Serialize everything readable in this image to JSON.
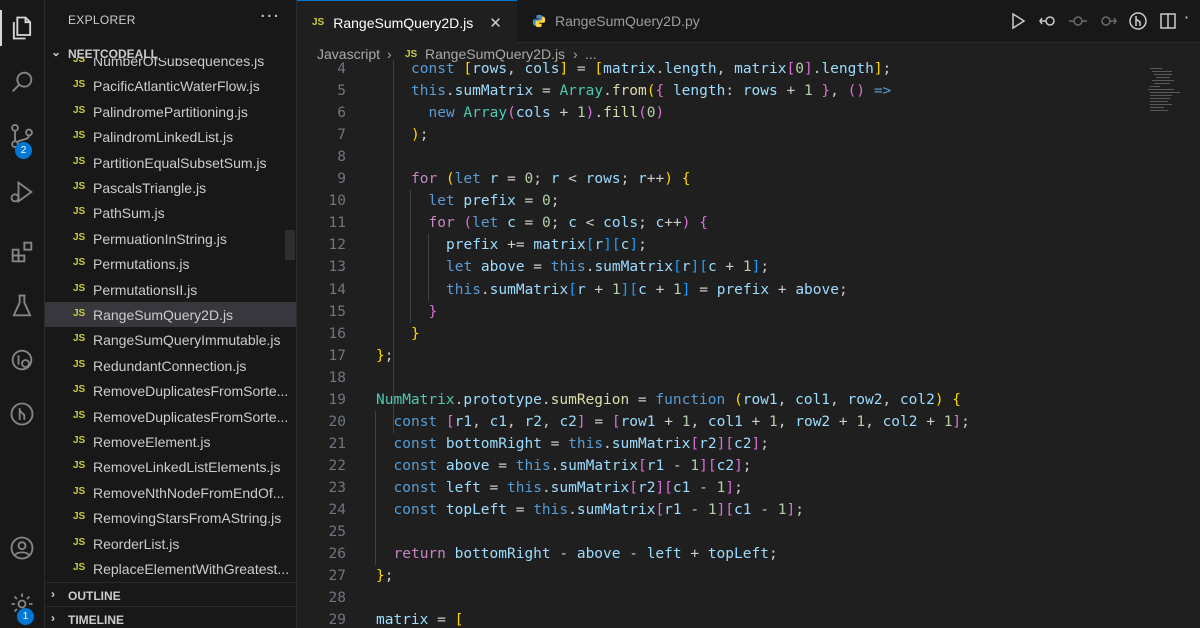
{
  "colors": {
    "accent": "#0078d4",
    "js_icon": "#cbcb41",
    "selection": "#37373d"
  },
  "activity_bar": {
    "items": [
      {
        "name": "explorer-icon"
      },
      {
        "name": "search-icon"
      },
      {
        "name": "source-control-icon",
        "badge": "2"
      },
      {
        "name": "run-debug-icon"
      },
      {
        "name": "extensions-icon"
      },
      {
        "name": "testing-icon"
      },
      {
        "name": "remote-explorer-icon"
      },
      {
        "name": "github-icon"
      },
      {
        "name": "account-icon"
      },
      {
        "name": "settings-gear-icon",
        "badge": "1"
      }
    ]
  },
  "sidebar": {
    "title": "EXPLORER",
    "more": "···",
    "folder": "NEETCODEALL",
    "file_icon_label": "JS",
    "files": [
      "NumberOfSubsequences.js",
      "PacificAtlanticWaterFlow.js",
      "PalindromePartitioning.js",
      "PalindromLinkedList.js",
      "PartitionEqualSubsetSum.js",
      "PascalsTriangle.js",
      "PathSum.js",
      "PermuationInString.js",
      "Permutations.js",
      "PermutationsII.js",
      "RangeSumQuery2D.js",
      "RangeSumQueryImmutable.js",
      "RedundantConnection.js",
      "RemoveDuplicatesFromSorte...",
      "RemoveDuplicatesFromSorte...",
      "RemoveElement.js",
      "RemoveLinkedListElements.js",
      "RemoveNthNodeFromEndOf...",
      "RemovingStarsFromAString.js",
      "ReorderList.js",
      "ReplaceElementWithGreatest..."
    ],
    "selected_file": "RangeSumQuery2D.js",
    "outline": "OUTLINE",
    "timeline": "TIMELINE"
  },
  "tabs": [
    {
      "label": "RangeSumQuery2D.js",
      "icon": "JS",
      "active": true,
      "close": "✕"
    },
    {
      "label": "RangeSumQuery2D.py",
      "icon": "python-icon",
      "active": false
    }
  ],
  "breadcrumb": {
    "part1": "Javascript",
    "sep": "›",
    "icon": "JS",
    "part2": "RangeSumQuery2D.js",
    "part3": "...",
    "sep2": "›"
  },
  "editor": {
    "line_numbers": [
      "4",
      "5",
      "6",
      "7",
      "8",
      "9",
      "10",
      "11",
      "12",
      "13",
      "14",
      "15",
      "16",
      "17",
      "18",
      "19",
      "20",
      "21",
      "22",
      "23",
      "24",
      "25",
      "26",
      "27",
      "28",
      "29"
    ],
    "lines": [
      [
        [
          "k",
          "const "
        ],
        [
          "b1",
          "["
        ],
        [
          "v",
          "rows"
        ],
        [
          "p",
          ", "
        ],
        [
          "v",
          "cols"
        ],
        [
          "b1",
          "]"
        ],
        [
          "p",
          " = "
        ],
        [
          "b1",
          "["
        ],
        [
          "v",
          "matrix"
        ],
        [
          "p",
          "."
        ],
        [
          "v",
          "length"
        ],
        [
          "p",
          ", "
        ],
        [
          "v",
          "matrix"
        ],
        [
          "b2",
          "["
        ],
        [
          "n",
          "0"
        ],
        [
          "b2",
          "]"
        ],
        [
          "p",
          "."
        ],
        [
          "v",
          "length"
        ],
        [
          "b1",
          "]"
        ],
        [
          "p",
          ";"
        ]
      ],
      [
        [
          "k",
          "this"
        ],
        [
          "p",
          "."
        ],
        [
          "v",
          "sumMatrix"
        ],
        [
          "p",
          " = "
        ],
        [
          "cl",
          "Array"
        ],
        [
          "p",
          "."
        ],
        [
          "fn",
          "from"
        ],
        [
          "b1",
          "("
        ],
        [
          "b2",
          "{ "
        ],
        [
          "v",
          "length"
        ],
        [
          "p",
          ": "
        ],
        [
          "v",
          "rows"
        ],
        [
          "p",
          " + "
        ],
        [
          "n",
          "1"
        ],
        [
          "b2",
          " }"
        ],
        [
          "p",
          ", "
        ],
        [
          "b2",
          "()"
        ],
        [
          "p",
          " "
        ],
        [
          "k",
          "=>"
        ]
      ],
      [
        [
          "k",
          "new "
        ],
        [
          "cl",
          "Array"
        ],
        [
          "b2",
          "("
        ],
        [
          "v",
          "cols"
        ],
        [
          "p",
          " + "
        ],
        [
          "n",
          "1"
        ],
        [
          "b2",
          ")"
        ],
        [
          "p",
          "."
        ],
        [
          "fn",
          "fill"
        ],
        [
          "b2",
          "("
        ],
        [
          "n",
          "0"
        ],
        [
          "b2",
          ")"
        ]
      ],
      [
        [
          "b1",
          ")"
        ],
        [
          "p",
          ";"
        ]
      ],
      [],
      [
        [
          "kw",
          "for "
        ],
        [
          "b1",
          "("
        ],
        [
          "k",
          "let "
        ],
        [
          "v",
          "r"
        ],
        [
          "p",
          " = "
        ],
        [
          "n",
          "0"
        ],
        [
          "p",
          "; "
        ],
        [
          "v",
          "r"
        ],
        [
          "p",
          " < "
        ],
        [
          "v",
          "rows"
        ],
        [
          "p",
          "; "
        ],
        [
          "v",
          "r"
        ],
        [
          "p",
          "++"
        ],
        [
          "b1",
          ")"
        ],
        [
          "p",
          " "
        ],
        [
          "b1",
          "{"
        ]
      ],
      [
        [
          "k",
          "let "
        ],
        [
          "v",
          "prefix"
        ],
        [
          "p",
          " = "
        ],
        [
          "n",
          "0"
        ],
        [
          "p",
          ";"
        ]
      ],
      [
        [
          "kw",
          "for "
        ],
        [
          "b2",
          "("
        ],
        [
          "k",
          "let "
        ],
        [
          "v",
          "c"
        ],
        [
          "p",
          " = "
        ],
        [
          "n",
          "0"
        ],
        [
          "p",
          "; "
        ],
        [
          "v",
          "c"
        ],
        [
          "p",
          " < "
        ],
        [
          "v",
          "cols"
        ],
        [
          "p",
          "; "
        ],
        [
          "v",
          "c"
        ],
        [
          "p",
          "++"
        ],
        [
          "b2",
          ")"
        ],
        [
          "p",
          " "
        ],
        [
          "b2",
          "{"
        ]
      ],
      [
        [
          "v",
          "prefix"
        ],
        [
          "p",
          " += "
        ],
        [
          "v",
          "matrix"
        ],
        [
          "b3",
          "["
        ],
        [
          "v",
          "r"
        ],
        [
          "b3",
          "]["
        ],
        [
          "v",
          "c"
        ],
        [
          "b3",
          "]"
        ],
        [
          "p",
          ";"
        ]
      ],
      [
        [
          "k",
          "let "
        ],
        [
          "v",
          "above"
        ],
        [
          "p",
          " = "
        ],
        [
          "k",
          "this"
        ],
        [
          "p",
          "."
        ],
        [
          "v",
          "sumMatrix"
        ],
        [
          "b3",
          "["
        ],
        [
          "v",
          "r"
        ],
        [
          "b3",
          "]["
        ],
        [
          "v",
          "c"
        ],
        [
          "p",
          " + "
        ],
        [
          "n",
          "1"
        ],
        [
          "b3",
          "]"
        ],
        [
          "p",
          ";"
        ]
      ],
      [
        [
          "k",
          "this"
        ],
        [
          "p",
          "."
        ],
        [
          "v",
          "sumMatrix"
        ],
        [
          "b3",
          "["
        ],
        [
          "v",
          "r"
        ],
        [
          "p",
          " + "
        ],
        [
          "n",
          "1"
        ],
        [
          "b3",
          "]["
        ],
        [
          "v",
          "c"
        ],
        [
          "p",
          " + "
        ],
        [
          "n",
          "1"
        ],
        [
          "b3",
          "]"
        ],
        [
          "p",
          " = "
        ],
        [
          "v",
          "prefix"
        ],
        [
          "p",
          " + "
        ],
        [
          "v",
          "above"
        ],
        [
          "p",
          ";"
        ]
      ],
      [
        [
          "b2",
          "}"
        ]
      ],
      [
        [
          "b1",
          "}"
        ]
      ],
      [
        [
          "b1",
          "}"
        ],
        [
          "p",
          ";"
        ]
      ],
      [],
      [
        [
          "cl",
          "NumMatrix"
        ],
        [
          "p",
          "."
        ],
        [
          "v",
          "prototype"
        ],
        [
          "p",
          "."
        ],
        [
          "fn",
          "sumRegion"
        ],
        [
          "p",
          " = "
        ],
        [
          "k",
          "function "
        ],
        [
          "b1",
          "("
        ],
        [
          "v",
          "row1"
        ],
        [
          "p",
          ", "
        ],
        [
          "v",
          "col1"
        ],
        [
          "p",
          ", "
        ],
        [
          "v",
          "row2"
        ],
        [
          "p",
          ", "
        ],
        [
          "v",
          "col2"
        ],
        [
          "b1",
          ")"
        ],
        [
          "p",
          " "
        ],
        [
          "b1",
          "{"
        ]
      ],
      [
        [
          "k",
          "const "
        ],
        [
          "b2",
          "["
        ],
        [
          "v",
          "r1"
        ],
        [
          "p",
          ", "
        ],
        [
          "v",
          "c1"
        ],
        [
          "p",
          ", "
        ],
        [
          "v",
          "r2"
        ],
        [
          "p",
          ", "
        ],
        [
          "v",
          "c2"
        ],
        [
          "b2",
          "]"
        ],
        [
          "p",
          " = "
        ],
        [
          "b2",
          "["
        ],
        [
          "v",
          "row1"
        ],
        [
          "p",
          " + "
        ],
        [
          "n",
          "1"
        ],
        [
          "p",
          ", "
        ],
        [
          "v",
          "col1"
        ],
        [
          "p",
          " + "
        ],
        [
          "n",
          "1"
        ],
        [
          "p",
          ", "
        ],
        [
          "v",
          "row2"
        ],
        [
          "p",
          " + "
        ],
        [
          "n",
          "1"
        ],
        [
          "p",
          ", "
        ],
        [
          "v",
          "col2"
        ],
        [
          "p",
          " + "
        ],
        [
          "n",
          "1"
        ],
        [
          "b2",
          "]"
        ],
        [
          "p",
          ";"
        ]
      ],
      [
        [
          "k",
          "const "
        ],
        [
          "v",
          "bottomRight"
        ],
        [
          "p",
          " = "
        ],
        [
          "k",
          "this"
        ],
        [
          "p",
          "."
        ],
        [
          "v",
          "sumMatrix"
        ],
        [
          "b2",
          "["
        ],
        [
          "v",
          "r2"
        ],
        [
          "b2",
          "]["
        ],
        [
          "v",
          "c2"
        ],
        [
          "b2",
          "]"
        ],
        [
          "p",
          ";"
        ]
      ],
      [
        [
          "k",
          "const "
        ],
        [
          "v",
          "above"
        ],
        [
          "p",
          " = "
        ],
        [
          "k",
          "this"
        ],
        [
          "p",
          "."
        ],
        [
          "v",
          "sumMatrix"
        ],
        [
          "b2",
          "["
        ],
        [
          "v",
          "r1"
        ],
        [
          "p",
          " - "
        ],
        [
          "n",
          "1"
        ],
        [
          "b2",
          "]["
        ],
        [
          "v",
          "c2"
        ],
        [
          "b2",
          "]"
        ],
        [
          "p",
          ";"
        ]
      ],
      [
        [
          "k",
          "const "
        ],
        [
          "v",
          "left"
        ],
        [
          "p",
          " = "
        ],
        [
          "k",
          "this"
        ],
        [
          "p",
          "."
        ],
        [
          "v",
          "sumMatrix"
        ],
        [
          "b2",
          "["
        ],
        [
          "v",
          "r2"
        ],
        [
          "b2",
          "]["
        ],
        [
          "v",
          "c1"
        ],
        [
          "p",
          " - "
        ],
        [
          "n",
          "1"
        ],
        [
          "b2",
          "]"
        ],
        [
          "p",
          ";"
        ]
      ],
      [
        [
          "k",
          "const "
        ],
        [
          "v",
          "topLeft"
        ],
        [
          "p",
          " = "
        ],
        [
          "k",
          "this"
        ],
        [
          "p",
          "."
        ],
        [
          "v",
          "sumMatrix"
        ],
        [
          "b2",
          "["
        ],
        [
          "v",
          "r1"
        ],
        [
          "p",
          " - "
        ],
        [
          "n",
          "1"
        ],
        [
          "b2",
          "]["
        ],
        [
          "v",
          "c1"
        ],
        [
          "p",
          " - "
        ],
        [
          "n",
          "1"
        ],
        [
          "b2",
          "]"
        ],
        [
          "p",
          ";"
        ]
      ],
      [],
      [
        [
          "kw",
          "return "
        ],
        [
          "v",
          "bottomRight"
        ],
        [
          "p",
          " - "
        ],
        [
          "v",
          "above"
        ],
        [
          "p",
          " - "
        ],
        [
          "v",
          "left"
        ],
        [
          "p",
          " + "
        ],
        [
          "v",
          "topLeft"
        ],
        [
          "p",
          ";"
        ]
      ],
      [
        [
          "b1",
          "}"
        ],
        [
          "p",
          ";"
        ]
      ],
      [],
      [
        [
          "v",
          "matrix"
        ],
        [
          "p",
          " = "
        ],
        [
          "b1",
          "["
        ]
      ]
    ],
    "indents": [
      2,
      2,
      3,
      2,
      0,
      2,
      3,
      3,
      4,
      4,
      4,
      3,
      2,
      0,
      0,
      0,
      1,
      1,
      1,
      1,
      1,
      0,
      1,
      0,
      0,
      0
    ]
  }
}
